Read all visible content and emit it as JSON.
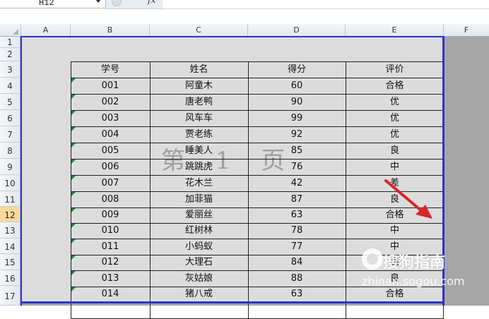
{
  "formula_bar": {
    "name_box_value": "H12",
    "fx_label": "fx"
  },
  "columns": [
    "A",
    "B",
    "C",
    "D",
    "E",
    "F"
  ],
  "rows": [
    "1",
    "2",
    "3",
    "4",
    "5",
    "6",
    "7",
    "8",
    "9",
    "10",
    "11",
    "12",
    "13",
    "14",
    "15",
    "16",
    "17"
  ],
  "selected_row": "12",
  "table": {
    "headers": [
      "学号",
      "姓名",
      "得分",
      "评价"
    ],
    "rows": [
      [
        "001",
        "阿童木",
        "60",
        "合格"
      ],
      [
        "002",
        "唐老鸭",
        "90",
        "优"
      ],
      [
        "003",
        "风车车",
        "99",
        "优"
      ],
      [
        "004",
        "贾老练",
        "92",
        "优"
      ],
      [
        "005",
        "睡美人",
        "85",
        "良"
      ],
      [
        "006",
        "跳跳虎",
        "76",
        "中"
      ],
      [
        "007",
        "花木兰",
        "42",
        "差"
      ],
      [
        "008",
        "加菲猫",
        "87",
        "良"
      ],
      [
        "009",
        "爱丽丝",
        "63",
        "合格"
      ],
      [
        "010",
        "红树林",
        "78",
        "中"
      ],
      [
        "011",
        "小蚂蚁",
        "77",
        "中"
      ],
      [
        "012",
        "大理石",
        "84",
        "良"
      ],
      [
        "013",
        "灰姑娘",
        "88",
        "良"
      ],
      [
        "014",
        "猪八戒",
        "63",
        "合格"
      ]
    ]
  },
  "page_watermark": "第 1 页",
  "colors": {
    "page_break_border": "#2b35c9",
    "page_background": "#dcdcdc",
    "outside_area": "#a6a6a6",
    "selected_row_header": "#f9d99a",
    "arrow": "#d6262b"
  },
  "logo": {
    "title": "搜狗指南",
    "url": "zhinan.sogou.com"
  }
}
